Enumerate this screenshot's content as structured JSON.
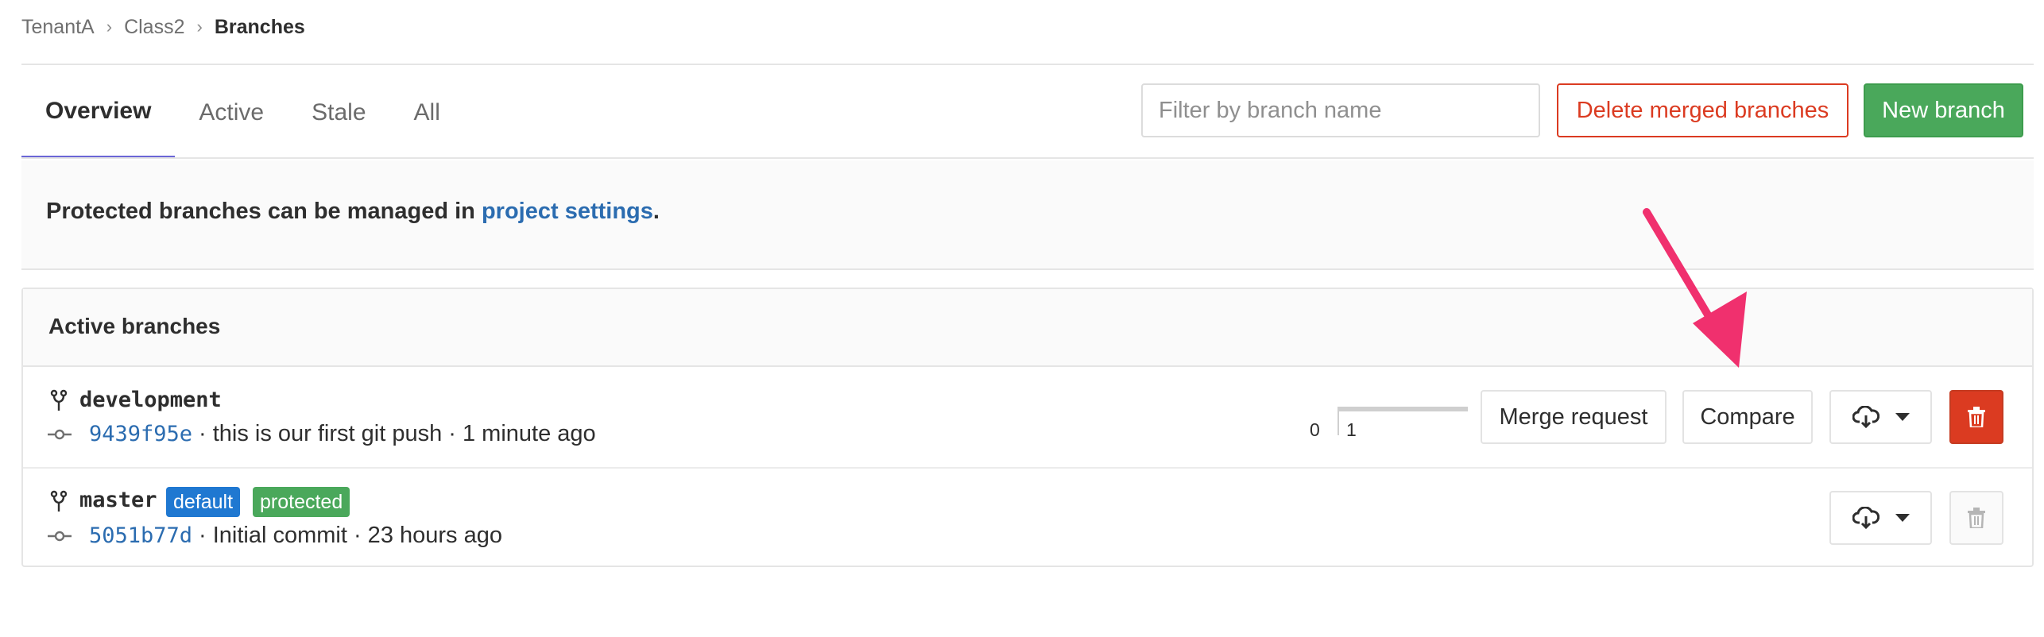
{
  "breadcrumb": [
    "TenantA",
    "Class2",
    "Branches"
  ],
  "tabs": [
    {
      "label": "Overview",
      "active": true
    },
    {
      "label": "Active",
      "active": false
    },
    {
      "label": "Stale",
      "active": false
    },
    {
      "label": "All",
      "active": false
    }
  ],
  "filter": {
    "placeholder": "Filter by branch name",
    "value": ""
  },
  "buttons": {
    "delete_merged": "Delete merged branches",
    "new_branch": "New branch"
  },
  "banner": {
    "prefix": "Protected branches can be managed in ",
    "link": "project settings",
    "suffix": "."
  },
  "panel": {
    "title": "Active branches"
  },
  "branches": [
    {
      "name": "development",
      "sha": "9439f95e",
      "message": "· this is our first git push · 1 minute ago",
      "divergence": {
        "behind": "0",
        "ahead": "1"
      },
      "actions": {
        "merge_request": "Merge request",
        "compare": "Compare"
      }
    },
    {
      "name": "master",
      "badges": [
        "default",
        "protected"
      ],
      "sha": "5051b77d",
      "message": "· Initial commit · 23 hours ago"
    }
  ],
  "colors": {
    "accent_tab": "#6b66d6",
    "danger": "#db3b21",
    "success": "#4aa85b",
    "link": "#2b6cb0",
    "badge_default": "#1f78d1",
    "annotation_arrow": "#f0306e"
  },
  "icons": [
    "branch-icon",
    "commit-icon",
    "download-cloud-icon",
    "caret-down-icon",
    "trash-icon",
    "chevron-right-icon"
  ]
}
